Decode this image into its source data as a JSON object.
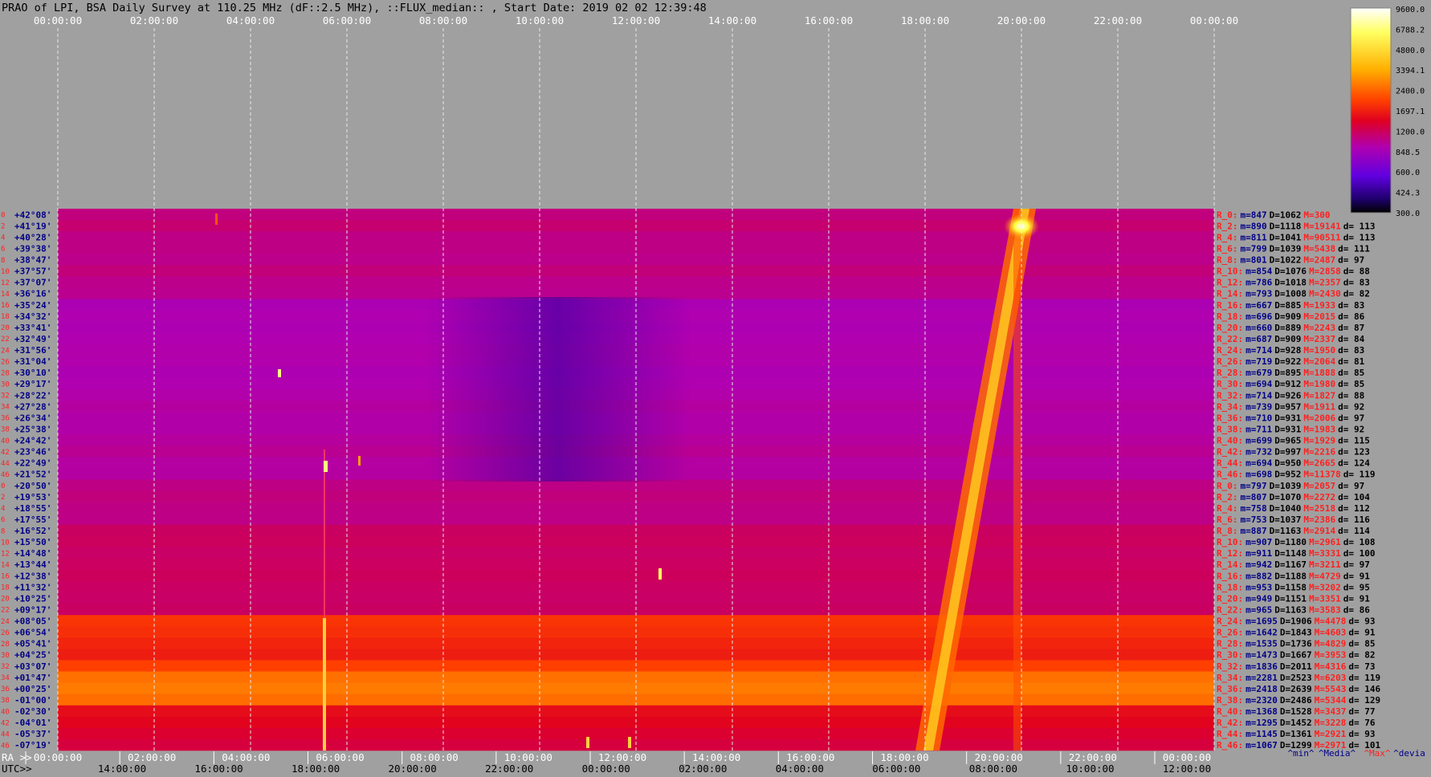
{
  "title": "PRAO of LPI, BSA Daily Survey at 110.25 MHz (dF::2.5 MHz), ::FLUX_median:: , Start Date: 2019 02 02 12:39:48",
  "colors": {
    "background": "#a0a0a0",
    "axis_text": "#ffffff",
    "label_text": "#000088",
    "highlight_text": "#ff2020",
    "grid": "#e8e8e8"
  },
  "axes": {
    "ra_label": "RA >>",
    "utc_label": "UTC>>",
    "top_ticks": [
      "00:00:00",
      "02:00:00",
      "04:00:00",
      "06:00:00",
      "08:00:00",
      "10:00:00",
      "12:00:00",
      "14:00:00",
      "16:00:00",
      "18:00:00",
      "20:00:00",
      "22:00:00",
      "00:00:00"
    ],
    "ra_ticks": [
      "00:00:00",
      "02:00:00",
      "04:00:00",
      "06:00:00",
      "08:00:00",
      "10:00:00",
      "12:00:00",
      "14:00:00",
      "16:00:00",
      "18:00:00",
      "20:00:00",
      "22:00:00",
      "00:00:00"
    ],
    "utc_ticks": [
      "14:00:00",
      "16:00:00",
      "18:00:00",
      "20:00:00",
      "22:00:00",
      "00:00:00",
      "02:00:00",
      "04:00:00",
      "06:00:00",
      "08:00:00",
      "10:00:00",
      "12:00:00"
    ],
    "stats_headers": [
      "^min^",
      "^Media^",
      "^Max^",
      "^devia"
    ]
  },
  "chart_data": {
    "type": "heatmap",
    "colorbar": {
      "labels": [
        "9600.0",
        "6788.2",
        "4800.0",
        "3394.1",
        "2400.0",
        "1697.1",
        "1200.0",
        "848.5",
        "600.0",
        "424.3",
        "300.0"
      ],
      "range": [
        300,
        9600
      ],
      "scale": "log"
    },
    "x_range_hours": [
      0,
      24
    ],
    "row_numbers": [
      "0",
      "2",
      "4",
      "6",
      "8",
      "10",
      "12",
      "14",
      "16",
      "18",
      "20",
      "22",
      "24",
      "26",
      "28",
      "30",
      "32",
      "34",
      "36",
      "38",
      "40",
      "42",
      "44",
      "46",
      "0",
      "2",
      "4",
      "6",
      "8",
      "10",
      "12",
      "14",
      "16",
      "18",
      "20",
      "22",
      "24",
      "26",
      "28",
      "30",
      "32",
      "34",
      "36",
      "38",
      "40",
      "42",
      "44",
      "46"
    ],
    "declinations": [
      "+42°08'",
      "+41°19'",
      "+40°28'",
      "+39°38'",
      "+38°47'",
      "+37°57'",
      "+37°07'",
      "+36°16'",
      "+35°24'",
      "+34°32'",
      "+33°41'",
      "+32°49'",
      "+31°56'",
      "+31°04'",
      "+30°10'",
      "+29°17'",
      "+28°22'",
      "+27°28'",
      "+26°34'",
      "+25°38'",
      "+24°42'",
      "+23°46'",
      "+22°49'",
      "+21°52'",
      "+20°50'",
      "+19°53'",
      "+18°55'",
      "+17°55'",
      "+16°52'",
      "+15°50'",
      "+14°48'",
      "+13°44'",
      "+12°38'",
      "+11°32'",
      "+10°25'",
      "+09°17'",
      "+08°05'",
      "+06°54'",
      "+05°41'",
      "+04°25'",
      "+03°07'",
      "+01°47'",
      "+00°25'",
      "-01°00'",
      "-02°30'",
      "-04°01'",
      "-05°37'",
      "-07°19'"
    ],
    "rows": [
      {
        "name": "R_0:",
        "min": "m=847",
        "med": "D=1062",
        "max": "M=300",
        "dev": ""
      },
      {
        "name": "R_2:",
        "min": "m=890",
        "med": "D=1118",
        "max": "M=19141",
        "dev": "d= 113"
      },
      {
        "name": "R_4:",
        "min": "m=811",
        "med": "D=1041",
        "max": "M=90511",
        "dev": "d= 113"
      },
      {
        "name": "R_6:",
        "min": "m=799",
        "med": "D=1039",
        "max": "M=5438",
        "dev": "d= 111"
      },
      {
        "name": "R_8:",
        "min": "m=801",
        "med": "D=1022",
        "max": "M=2487",
        "dev": "d= 97"
      },
      {
        "name": "R_10:",
        "min": "m=854",
        "med": "D=1076",
        "max": "M=2858",
        "dev": "d= 88"
      },
      {
        "name": "R_12:",
        "min": "m=786",
        "med": "D=1018",
        "max": "M=2357",
        "dev": "d= 83"
      },
      {
        "name": "R_14:",
        "min": "m=793",
        "med": "D=1008",
        "max": "M=2430",
        "dev": "d= 82"
      },
      {
        "name": "R_16:",
        "min": "m=667",
        "med": "D=885",
        "max": "M=1933",
        "dev": "d= 83"
      },
      {
        "name": "R_18:",
        "min": "m=696",
        "med": "D=909",
        "max": "M=2015",
        "dev": "d= 86"
      },
      {
        "name": "R_20:",
        "min": "m=660",
        "med": "D=889",
        "max": "M=2243",
        "dev": "d= 87"
      },
      {
        "name": "R_22:",
        "min": "m=687",
        "med": "D=909",
        "max": "M=2337",
        "dev": "d= 84"
      },
      {
        "name": "R_24:",
        "min": "m=714",
        "med": "D=928",
        "max": "M=1950",
        "dev": "d= 83"
      },
      {
        "name": "R_26:",
        "min": "m=719",
        "med": "D=922",
        "max": "M=2064",
        "dev": "d= 81"
      },
      {
        "name": "R_28:",
        "min": "m=679",
        "med": "D=895",
        "max": "M=1888",
        "dev": "d= 85"
      },
      {
        "name": "R_30:",
        "min": "m=694",
        "med": "D=912",
        "max": "M=1980",
        "dev": "d= 85"
      },
      {
        "name": "R_32:",
        "min": "m=714",
        "med": "D=926",
        "max": "M=1827",
        "dev": "d= 88"
      },
      {
        "name": "R_34:",
        "min": "m=739",
        "med": "D=957",
        "max": "M=1911",
        "dev": "d= 92"
      },
      {
        "name": "R_36:",
        "min": "m=710",
        "med": "D=931",
        "max": "M=2006",
        "dev": "d= 97"
      },
      {
        "name": "R_38:",
        "min": "m=711",
        "med": "D=931",
        "max": "M=1983",
        "dev": "d= 92"
      },
      {
        "name": "R_40:",
        "min": "m=699",
        "med": "D=965",
        "max": "M=1929",
        "dev": "d= 115"
      },
      {
        "name": "R_42:",
        "min": "m=732",
        "med": "D=997",
        "max": "M=2216",
        "dev": "d= 123"
      },
      {
        "name": "R_44:",
        "min": "m=694",
        "med": "D=950",
        "max": "M=2665",
        "dev": "d= 124"
      },
      {
        "name": "R_46:",
        "min": "m=698",
        "med": "D=952",
        "max": "M=11378",
        "dev": "d= 119"
      },
      {
        "name": "R_0:",
        "min": "m=797",
        "med": "D=1039",
        "max": "M=2057",
        "dev": "d= 97"
      },
      {
        "name": "R_2:",
        "min": "m=807",
        "med": "D=1070",
        "max": "M=2272",
        "dev": "d= 104"
      },
      {
        "name": "R_4:",
        "min": "m=758",
        "med": "D=1040",
        "max": "M=2518",
        "dev": "d= 112"
      },
      {
        "name": "R_6:",
        "min": "m=753",
        "med": "D=1037",
        "max": "M=2386",
        "dev": "d= 116"
      },
      {
        "name": "R_8:",
        "min": "m=887",
        "med": "D=1163",
        "max": "M=2914",
        "dev": "d= 114"
      },
      {
        "name": "R_10:",
        "min": "m=907",
        "med": "D=1180",
        "max": "M=2961",
        "dev": "d= 108"
      },
      {
        "name": "R_12:",
        "min": "m=911",
        "med": "D=1148",
        "max": "M=3331",
        "dev": "d= 100"
      },
      {
        "name": "R_14:",
        "min": "m=942",
        "med": "D=1167",
        "max": "M=3211",
        "dev": "d= 97"
      },
      {
        "name": "R_16:",
        "min": "m=882",
        "med": "D=1188",
        "max": "M=4729",
        "dev": "d= 91"
      },
      {
        "name": "R_18:",
        "min": "m=953",
        "med": "D=1158",
        "max": "M=3202",
        "dev": "d= 95"
      },
      {
        "name": "R_20:",
        "min": "m=949",
        "med": "D=1151",
        "max": "M=3351",
        "dev": "d= 91"
      },
      {
        "name": "R_22:",
        "min": "m=965",
        "med": "D=1163",
        "max": "M=3583",
        "dev": "d= 86"
      },
      {
        "name": "R_24:",
        "min": "m=1695",
        "med": "D=1906",
        "max": "M=4478",
        "dev": "d= 93"
      },
      {
        "name": "R_26:",
        "min": "m=1642",
        "med": "D=1843",
        "max": "M=4603",
        "dev": "d= 91"
      },
      {
        "name": "R_28:",
        "min": "m=1535",
        "med": "D=1736",
        "max": "M=4829",
        "dev": "d= 85"
      },
      {
        "name": "R_30:",
        "min": "m=1473",
        "med": "D=1667",
        "max": "M=3953",
        "dev": "d= 82"
      },
      {
        "name": "R_32:",
        "min": "m=1836",
        "med": "D=2011",
        "max": "M=4316",
        "dev": "d= 73"
      },
      {
        "name": "R_34:",
        "min": "m=2281",
        "med": "D=2523",
        "max": "M=6203",
        "dev": "d= 119"
      },
      {
        "name": "R_36:",
        "min": "m=2418",
        "med": "D=2639",
        "max": "M=5543",
        "dev": "d= 146"
      },
      {
        "name": "R_38:",
        "min": "m=2320",
        "med": "D=2486",
        "max": "M=5344",
        "dev": "d= 129"
      },
      {
        "name": "R_40:",
        "min": "m=1368",
        "med": "D=1528",
        "max": "M=3437",
        "dev": "d= 77"
      },
      {
        "name": "R_42:",
        "min": "m=1295",
        "med": "D=1452",
        "max": "M=3228",
        "dev": "d= 76"
      },
      {
        "name": "R_44:",
        "min": "m=1145",
        "med": "D=1361",
        "max": "M=2921",
        "dev": "d= 93"
      },
      {
        "name": "R_46:",
        "min": "m=1067",
        "med": "D=1299",
        "max": "M=2971",
        "dev": "d= 101"
      }
    ]
  }
}
